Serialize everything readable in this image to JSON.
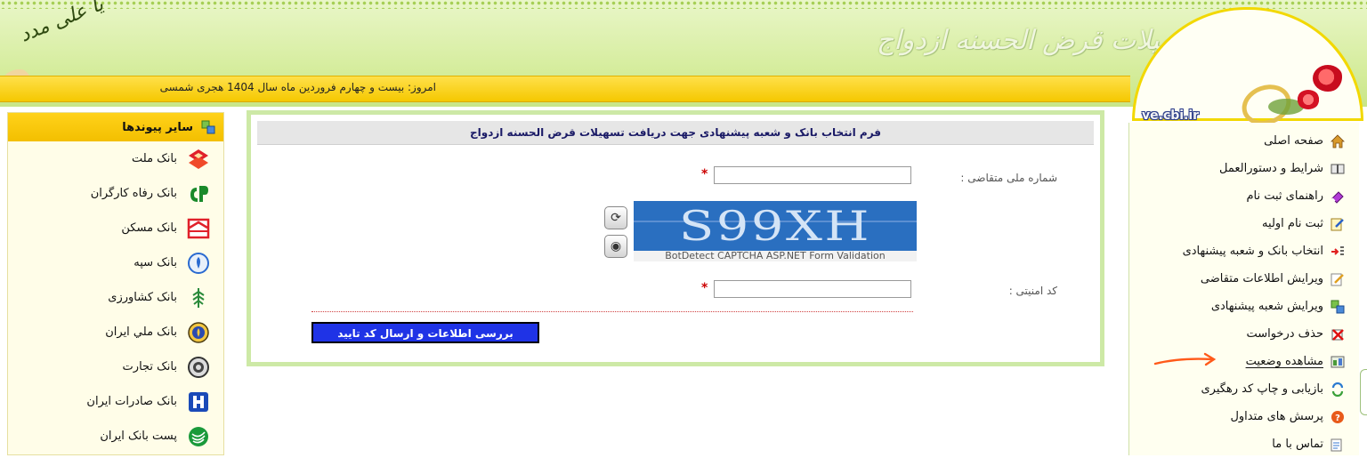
{
  "header": {
    "system_title": "سامانه تسهیلات قرض الحسنه ازدواج",
    "calligraphy_text": "یا علی مدد",
    "date_line": "امروز: بیست و چهارم فروردین ماه سال 1404 هجری شمسی",
    "logo_text": "ve.cbi.ir"
  },
  "right_nav": {
    "items": [
      {
        "label": "صفحه اصلی",
        "icon": "home-icon"
      },
      {
        "label": "شرایط و دستورالعمل",
        "icon": "book-icon"
      },
      {
        "label": "راهنمای ثبت نام",
        "icon": "eraser-icon"
      },
      {
        "label": "ثبت نام اولیه",
        "icon": "edit-form-icon"
      },
      {
        "label": "انتخاب بانک و شعبه پیشنهادی",
        "icon": "arrow-list-icon"
      },
      {
        "label": "ویرایش اطلاعات متقاضی",
        "icon": "edit-icon"
      },
      {
        "label": "ویرایش شعبه پیشنهادی",
        "icon": "swap-icon"
      },
      {
        "label": "حذف درخواست",
        "icon": "delete-icon"
      },
      {
        "label": "مشاهده وضعیت",
        "icon": "status-icon"
      },
      {
        "label": "بازیابی و چاپ کد رهگیری",
        "icon": "refresh-icon"
      },
      {
        "label": "پرسش های متداول",
        "icon": "help-icon"
      },
      {
        "label": "تماس با ما",
        "icon": "contact-icon"
      }
    ]
  },
  "left_panel": {
    "title": "سایر پیوندها",
    "links": [
      {
        "label": "بانک ملت",
        "icon": "bank-mellat-icon"
      },
      {
        "label": "بانک رفاه کارگران",
        "icon": "bank-refah-icon"
      },
      {
        "label": "بانک مسکن",
        "icon": "bank-maskan-icon"
      },
      {
        "label": "بانک سپه",
        "icon": "bank-sepah-icon"
      },
      {
        "label": "بانک کشاورزی",
        "icon": "bank-keshavarzi-icon"
      },
      {
        "label": "بانک ملي ایران",
        "icon": "bank-melli-icon"
      },
      {
        "label": "بانک تجارت",
        "icon": "bank-tejarat-icon"
      },
      {
        "label": "بانک صادرات ایران",
        "icon": "bank-saderat-icon"
      },
      {
        "label": "پست بانک ایران",
        "icon": "post-bank-icon"
      }
    ]
  },
  "form": {
    "title": "فرم انتخاب بانک و شعبه پیشنهادی جهت دریافت تسهیلات قرض الحسنه ازدواج",
    "national_id_label": "شماره ملی متقاضی :",
    "national_id_value": "",
    "captcha_text": "S99XH",
    "captcha_caption": "BotDetect CAPTCHA ASP.NET Form Validation",
    "security_code_label": "کد امنیتی :",
    "security_code_value": "",
    "required_mark": "*",
    "submit_label": "بررسی اطلاعات و ارسال کد تایید"
  },
  "colors": {
    "header_green": "#d4ec9a",
    "yellow_strip": "#f5c800",
    "submit_blue": "#1f33e6",
    "form_border": "#cde9a6",
    "annotation": "#ff5a1a"
  }
}
